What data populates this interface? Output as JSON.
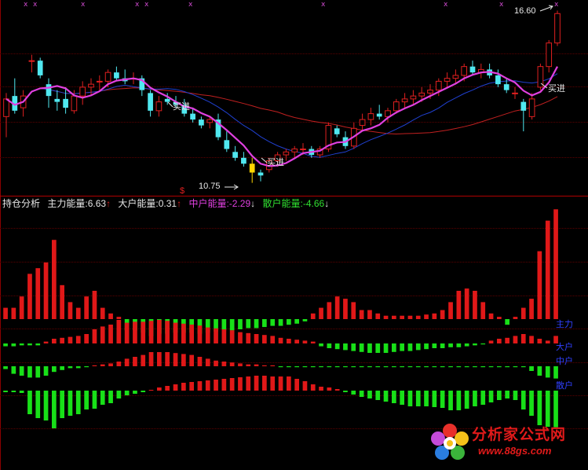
{
  "markers": [
    "x",
    "x",
    "x",
    "x",
    "x",
    "x",
    "x",
    "x",
    "x",
    "x"
  ],
  "price_high_label": "16.60",
  "price_low_label": "10.75",
  "buy_labels": [
    "买进",
    "买进",
    "买进"
  ],
  "dollar_sign": "$",
  "legend": {
    "indicator": "持仓分析",
    "main_label": "主力能量:",
    "main_value": "6.63",
    "main_arrow": "↑",
    "big_label": "大户能量:",
    "big_value": "0.31",
    "big_arrow": "↑",
    "mid_label": "中户能量:",
    "mid_value": "-2.29",
    "mid_arrow": "↓",
    "small_label": "散户能量:",
    "small_value": "-4.66",
    "small_arrow": "↓"
  },
  "side_labels": [
    "主力",
    "大户",
    "中户",
    "散户"
  ],
  "watermark": {
    "title": "分析家公式网",
    "url": "www.88gs.com"
  },
  "colors": {
    "up": "#e02020",
    "down": "#50e8f0",
    "ma_short": "#e040e0",
    "ma_mid": "#2040d0",
    "ma_long": "#c02020",
    "bar_pos": "#e01818",
    "bar_neg": "#18e018",
    "buy": "#ffd700"
  },
  "chart_data": [
    {
      "type": "candlestick",
      "title": "",
      "annotations": [
        "16.60",
        "10.75",
        "买进",
        "买进",
        "买进"
      ],
      "candles": [
        {
          "o": 13.0,
          "h": 13.8,
          "l": 12.3,
          "c": 13.6
        },
        {
          "o": 13.7,
          "h": 14.3,
          "l": 13.1,
          "c": 13.2
        },
        {
          "o": 13.3,
          "h": 13.9,
          "l": 13.0,
          "c": 13.7
        },
        {
          "o": 14.9,
          "h": 15.1,
          "l": 14.5,
          "c": 14.9
        },
        {
          "o": 14.9,
          "h": 15.0,
          "l": 14.3,
          "c": 14.4
        },
        {
          "o": 14.1,
          "h": 14.3,
          "l": 13.3,
          "c": 13.7
        },
        {
          "o": 13.6,
          "h": 13.9,
          "l": 13.2,
          "c": 13.5
        },
        {
          "o": 13.6,
          "h": 14.0,
          "l": 13.1,
          "c": 13.3
        },
        {
          "o": 13.2,
          "h": 13.9,
          "l": 13.1,
          "c": 13.7
        },
        {
          "o": 13.7,
          "h": 14.2,
          "l": 13.4,
          "c": 14.0
        },
        {
          "o": 14.0,
          "h": 14.3,
          "l": 13.7,
          "c": 14.1
        },
        {
          "o": 14.2,
          "h": 14.4,
          "l": 13.9,
          "c": 14.2
        },
        {
          "o": 14.2,
          "h": 14.6,
          "l": 14.0,
          "c": 14.5
        },
        {
          "o": 14.5,
          "h": 14.7,
          "l": 14.2,
          "c": 14.3
        },
        {
          "o": 14.3,
          "h": 14.6,
          "l": 14.1,
          "c": 14.2
        },
        {
          "o": 14.3,
          "h": 14.5,
          "l": 14.1,
          "c": 14.3
        },
        {
          "o": 14.3,
          "h": 14.4,
          "l": 13.7,
          "c": 13.9
        },
        {
          "o": 13.8,
          "h": 13.9,
          "l": 13.0,
          "c": 13.2
        },
        {
          "o": 13.2,
          "h": 13.7,
          "l": 13.0,
          "c": 13.5
        },
        {
          "o": 13.6,
          "h": 13.8,
          "l": 13.4,
          "c": 13.5
        },
        {
          "o": 13.5,
          "h": 13.7,
          "l": 13.3,
          "c": 13.4
        },
        {
          "o": 13.4,
          "h": 13.6,
          "l": 13.0,
          "c": 13.1
        },
        {
          "o": 13.1,
          "h": 13.3,
          "l": 12.8,
          "c": 12.9
        },
        {
          "o": 12.9,
          "h": 13.0,
          "l": 12.6,
          "c": 12.7
        },
        {
          "o": 12.8,
          "h": 13.0,
          "l": 12.6,
          "c": 12.9
        },
        {
          "o": 12.9,
          "h": 13.1,
          "l": 12.2,
          "c": 12.3
        },
        {
          "o": 12.2,
          "h": 12.5,
          "l": 11.8,
          "c": 11.9
        },
        {
          "o": 11.8,
          "h": 12.0,
          "l": 11.5,
          "c": 11.6
        },
        {
          "o": 11.6,
          "h": 11.8,
          "l": 11.3,
          "c": 11.4
        },
        {
          "o": 11.4,
          "h": 11.6,
          "l": 10.75,
          "c": 11.1
        },
        {
          "o": 11.1,
          "h": 11.2,
          "l": 10.8,
          "c": 11.0
        },
        {
          "o": 11.2,
          "h": 11.6,
          "l": 11.1,
          "c": 11.5
        },
        {
          "o": 11.5,
          "h": 11.8,
          "l": 11.3,
          "c": 11.7
        },
        {
          "o": 11.7,
          "h": 11.9,
          "l": 11.5,
          "c": 11.8
        },
        {
          "o": 11.8,
          "h": 12.0,
          "l": 11.6,
          "c": 11.9
        },
        {
          "o": 11.9,
          "h": 12.1,
          "l": 11.7,
          "c": 11.9
        },
        {
          "o": 11.9,
          "h": 12.0,
          "l": 11.6,
          "c": 11.7
        },
        {
          "o": 11.7,
          "h": 12.0,
          "l": 11.6,
          "c": 11.9
        },
        {
          "o": 11.9,
          "h": 12.8,
          "l": 11.8,
          "c": 12.7
        },
        {
          "o": 12.6,
          "h": 12.7,
          "l": 12.3,
          "c": 12.4
        },
        {
          "o": 12.3,
          "h": 12.5,
          "l": 11.9,
          "c": 12.0
        },
        {
          "o": 12.0,
          "h": 12.8,
          "l": 11.9,
          "c": 12.6
        },
        {
          "o": 12.7,
          "h": 13.1,
          "l": 12.5,
          "c": 12.9
        },
        {
          "o": 12.9,
          "h": 13.3,
          "l": 12.7,
          "c": 13.1
        },
        {
          "o": 13.1,
          "h": 13.4,
          "l": 12.9,
          "c": 13.0
        },
        {
          "o": 13.0,
          "h": 13.3,
          "l": 12.8,
          "c": 13.2
        },
        {
          "o": 13.2,
          "h": 13.6,
          "l": 13.1,
          "c": 13.5
        },
        {
          "o": 13.5,
          "h": 13.8,
          "l": 13.3,
          "c": 13.6
        },
        {
          "o": 13.6,
          "h": 13.9,
          "l": 13.4,
          "c": 13.7
        },
        {
          "o": 13.7,
          "h": 14.0,
          "l": 13.5,
          "c": 13.8
        },
        {
          "o": 13.8,
          "h": 14.1,
          "l": 13.6,
          "c": 13.9
        },
        {
          "o": 13.9,
          "h": 14.3,
          "l": 13.7,
          "c": 14.2
        },
        {
          "o": 14.2,
          "h": 14.5,
          "l": 14.0,
          "c": 14.3
        },
        {
          "o": 14.3,
          "h": 14.6,
          "l": 14.1,
          "c": 14.4
        },
        {
          "o": 14.4,
          "h": 14.8,
          "l": 14.2,
          "c": 14.7
        },
        {
          "o": 14.7,
          "h": 14.9,
          "l": 14.4,
          "c": 14.5
        },
        {
          "o": 14.5,
          "h": 14.8,
          "l": 14.3,
          "c": 14.6
        },
        {
          "o": 14.6,
          "h": 14.8,
          "l": 14.3,
          "c": 14.4
        },
        {
          "o": 14.4,
          "h": 14.6,
          "l": 14.0,
          "c": 14.1
        },
        {
          "o": 14.1,
          "h": 14.3,
          "l": 13.8,
          "c": 13.9
        },
        {
          "o": 13.8,
          "h": 14.0,
          "l": 13.6,
          "c": 13.8
        },
        {
          "o": 13.5,
          "h": 13.6,
          "l": 12.5,
          "c": 13.2
        },
        {
          "o": 13.0,
          "h": 13.8,
          "l": 12.9,
          "c": 13.6
        },
        {
          "o": 14.0,
          "h": 14.8,
          "l": 13.9,
          "c": 14.7
        },
        {
          "o": 14.7,
          "h": 15.6,
          "l": 14.5,
          "c": 15.5
        },
        {
          "o": 15.5,
          "h": 16.6,
          "l": 15.4,
          "c": 16.5
        }
      ],
      "ylim": [
        10.5,
        16.8
      ]
    },
    {
      "type": "bar",
      "title": "持仓分析",
      "series": [
        {
          "name": "主力",
          "values": [
            1,
            1,
            2,
            4,
            4.5,
            5,
            7,
            3,
            1.5,
            1,
            2,
            2.5,
            1,
            0.5,
            0.2,
            -1,
            -1,
            -1.2,
            -1.5,
            -1.3,
            -1.3,
            -1.2,
            -1.2,
            -1.2,
            -1.3,
            -1.2,
            -1.1,
            -1,
            -1,
            -0.9,
            -0.8,
            -0.8,
            -0.7,
            -0.6,
            -0.6,
            -0.5,
            -0.4,
            -0.2,
            0.5,
            1,
            1.5,
            2,
            1.8,
            1.5,
            0.8,
            0.8,
            0.5,
            0.3,
            0.3,
            0.3,
            0.3,
            0.3,
            0.4,
            0.5,
            0.8,
            1.5,
            2.5,
            2.7,
            2.5,
            1.5,
            0.5,
            0.2,
            -0.5,
            0.2,
            1,
            1.8,
            6,
            8.7,
            9.7
          ]
        },
        {
          "name": "大户",
          "values": [
            -0.3,
            -0.3,
            -0.2,
            -0.2,
            -0.2,
            0.2,
            0.5,
            0.6,
            0.7,
            0.8,
            1,
            1.5,
            1.8,
            2,
            2.5,
            2.2,
            2.3,
            2.3,
            2.4,
            2.5,
            2.4,
            2.2,
            2.1,
            2,
            1.9,
            1.7,
            1.6,
            1.5,
            1.4,
            1.2,
            1.1,
            1.0,
            0.9,
            0.8,
            0.6,
            0.5,
            0.4,
            0.3,
            0.2,
            -0.3,
            -0.5,
            -0.6,
            -0.7,
            -0.8,
            -0.9,
            -1,
            -1.0,
            -1.0,
            -0.9,
            -0.8,
            -0.8,
            -0.7,
            -0.6,
            -0.5,
            -0.5,
            -0.4,
            -0.4,
            -0.3,
            -0.2,
            -0.1,
            0.3,
            0.5,
            0.6,
            0.8,
            1.0,
            0.8,
            0.5,
            0.3,
            0.8
          ]
        },
        {
          "name": "中户",
          "values": [
            -0.3,
            -0.8,
            -1.0,
            -1.2,
            -1.2,
            -1.0,
            -0.6,
            -0.4,
            -0.2,
            -0.2,
            -0.1,
            0.1,
            0.2,
            0.3,
            0.5,
            0.8,
            1.0,
            1.2,
            1.5,
            1.5,
            1.5,
            1.4,
            1.3,
            1.2,
            1.0,
            0.8,
            0.6,
            0.5,
            0.4,
            0.3,
            0.2,
            0.2,
            0.1,
            0.1,
            -0.1,
            -0.1,
            -0.1,
            -0.1,
            -0.1,
            -0.1,
            -0.1,
            -0.1,
            -0.1,
            -0.1,
            -0.1,
            -0.1,
            -0.1,
            -0.1,
            -0.1,
            -0.1,
            -0.1,
            -0.1,
            -0.1,
            -0.1,
            -0.1,
            -0.1,
            -0.1,
            -0.1,
            -0.1,
            -0.1,
            -0.1,
            -0.1,
            -0.1,
            -0.1,
            -0.1,
            -0.5,
            -1.0,
            -1.2,
            -1.3
          ]
        },
        {
          "name": "散户",
          "values": [
            -0.2,
            -0.2,
            -0.3,
            -3,
            -3.5,
            -3.8,
            -4.8,
            -3.5,
            -3.2,
            -3.0,
            -2.4,
            -2.3,
            -1.8,
            -1.6,
            -1.0,
            -0.6,
            -0.4,
            -0.2,
            0.1,
            0.4,
            0.6,
            0.8,
            1.0,
            1.1,
            1.2,
            1.3,
            1.4,
            1.5,
            1.6,
            1.7,
            1.8,
            1.9,
            1.9,
            1.8,
            1.8,
            1.8,
            1.5,
            1.2,
            0.8,
            0.5,
            0.4,
            0.2,
            -0.2,
            -0.5,
            -0.8,
            -1.0,
            -1.2,
            -1.4,
            -1.6,
            -1.8,
            -2.0,
            -2.0,
            -2.0,
            -2.1,
            -2.2,
            -2.5,
            -2.5,
            -2.3,
            -2.0,
            -1.8,
            -1.5,
            -1.2,
            -1.0,
            -1.2,
            -2.4,
            -3.2,
            -4.4,
            -4.6,
            -4.66
          ]
        }
      ]
    }
  ]
}
